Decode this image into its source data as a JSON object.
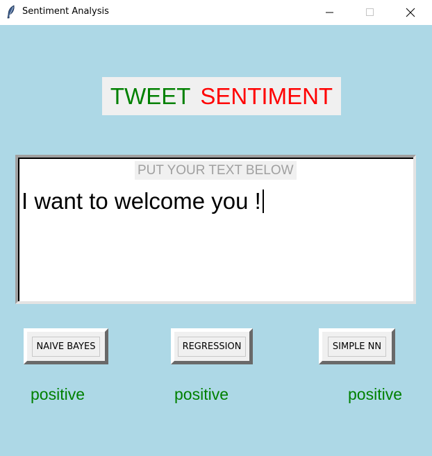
{
  "window": {
    "title": "Sentiment Analysis",
    "icon": "feather-icon"
  },
  "heading": {
    "word1": "TWEET",
    "word2": "SENTIMENT",
    "color1": "#008000",
    "color2": "#ff0000"
  },
  "input": {
    "placeholder_label": "PUT YOUR TEXT BELOW",
    "value": "I want to welcome you !"
  },
  "buttons": {
    "naive_bayes": "NAIVE BAYES",
    "regression": "REGRESSION",
    "simple_nn": "SIMPLE NN"
  },
  "results": {
    "naive_bayes": "positive",
    "regression": "positive",
    "simple_nn": "positive",
    "color": "#008000"
  },
  "colors": {
    "background": "#add8e6"
  }
}
